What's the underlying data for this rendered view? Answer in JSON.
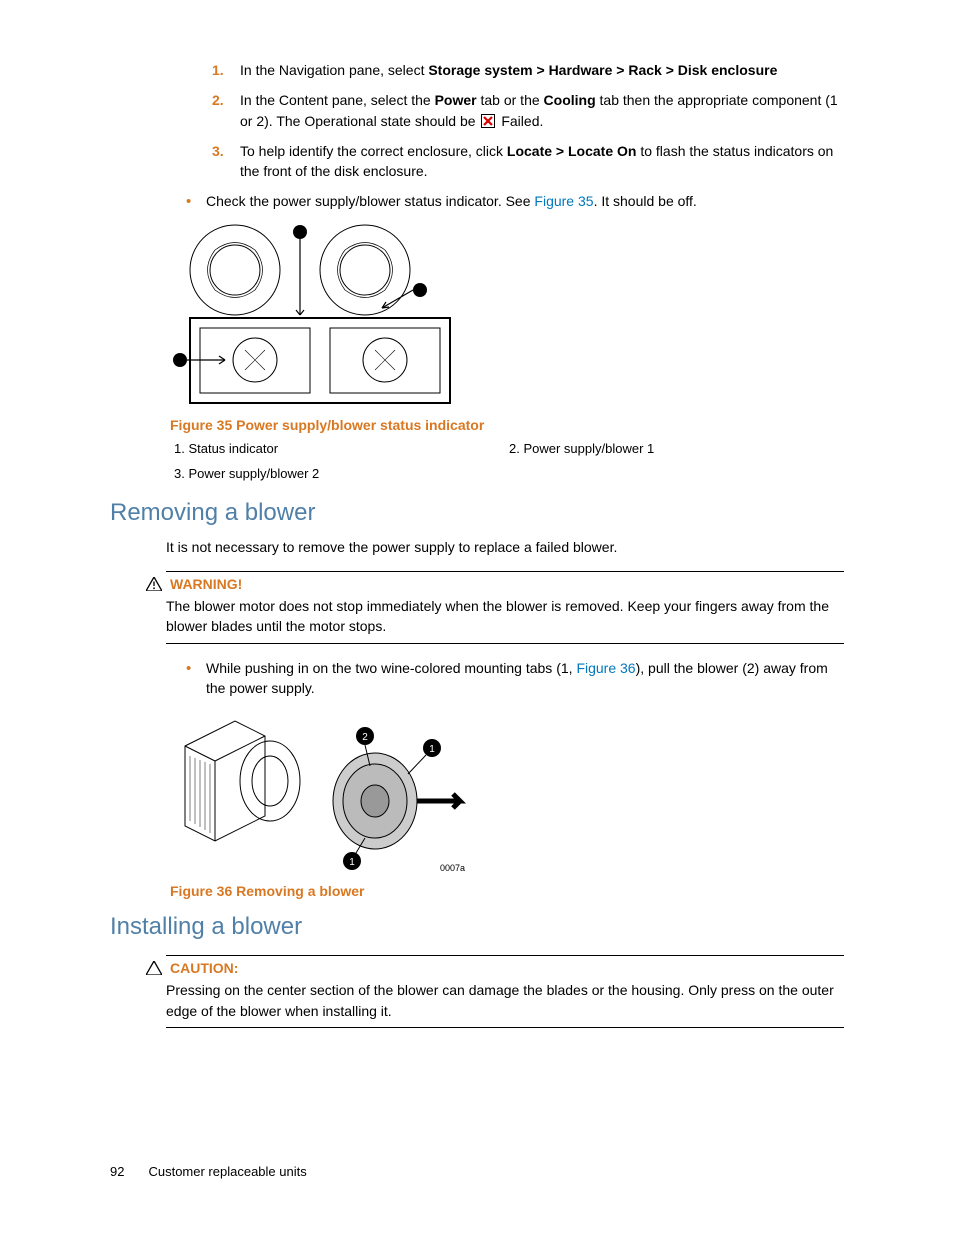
{
  "steps": {
    "s1_num": "1.",
    "s1_a": "In the Navigation pane, select ",
    "s1_b": "Storage system > Hardware > Rack > Disk enclosure",
    "s2_num": "2.",
    "s2_a": "In the Content pane, select the ",
    "s2_b": "Power",
    "s2_c": " tab or the ",
    "s2_d": "Cooling",
    "s2_e": " tab then the appropriate component (1 or 2). The Operational state should be ",
    "s2_f": " Failed.",
    "s3_num": "3.",
    "s3_a": "To help identify the correct enclosure, click ",
    "s3_b": "Locate > Locate On",
    "s3_c": " to flash the status indicators on the front of the disk enclosure."
  },
  "bullet1_a": "Check the power supply/blower status indicator. See ",
  "bullet1_link": "Figure 35",
  "bullet1_b": ". It should be off.",
  "fig35_caption": "Figure 35 Power supply/blower status indicator",
  "legend": {
    "i1": "1. Status indicator",
    "i2": "2. Power supply/blower 1",
    "i3": "3. Power supply/blower 2"
  },
  "h_removing": "Removing a blower",
  "removing_intro": "It is not necessary to remove the power supply to replace a failed blower.",
  "warning_title": "WARNING!",
  "warning_body": "The blower motor does not stop immediately when the blower is removed. Keep your fingers away from the blower blades until the motor stops.",
  "bullet2_a": "While pushing in on the two wine-colored mounting tabs (1, ",
  "bullet2_link": "Figure 36",
  "bullet2_b": "), pull the blower (2) away from the power supply.",
  "fig36_caption": "Figure 36 Removing a blower",
  "h_installing": "Installing a blower",
  "caution_title": "CAUTION:",
  "caution_body": "Pressing on the center section of the blower can damage the blades or the housing. Only press on the outer edge of the blower when installing it.",
  "footer_page": "92",
  "footer_text": "Customer replaceable units"
}
